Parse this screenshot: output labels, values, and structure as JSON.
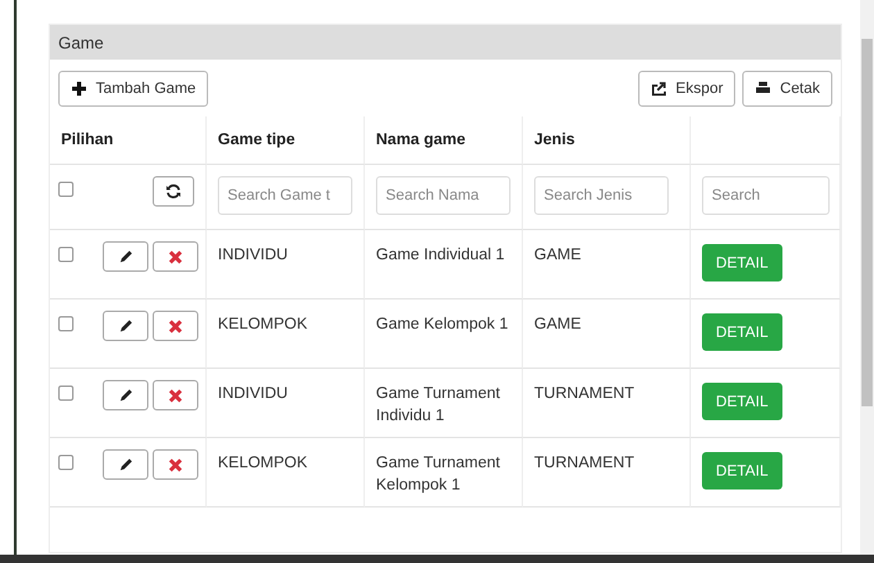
{
  "panel": {
    "title": "Game"
  },
  "toolbar": {
    "add_button": "Tambah Game",
    "export_button": "Ekspor",
    "print_button": "Cetak"
  },
  "table": {
    "columns": [
      "Pilihan",
      "Game tipe",
      "Nama game",
      "Jenis"
    ],
    "filters": {
      "select_all_checked": false,
      "placeholders": [
        "Search Game t",
        "Search Nama",
        "Search Jenis",
        "Search"
      ]
    },
    "rows": [
      {
        "checked": false,
        "game_tipe": "INDIVIDU",
        "nama_game": "Game Individual 1",
        "jenis": "GAME",
        "action": "DETAIL"
      },
      {
        "checked": false,
        "game_tipe": "KELOMPOK",
        "nama_game": "Game Kelompok 1",
        "jenis": "GAME",
        "action": "DETAIL"
      },
      {
        "checked": false,
        "game_tipe": "INDIVIDU",
        "nama_game": "Game Turnament Individu 1",
        "jenis": "TURNAMENT",
        "action": "DETAIL"
      },
      {
        "checked": false,
        "game_tipe": "KELOMPOK",
        "nama_game": "Game Turnament Kelompok 1",
        "jenis": "TURNAMENT",
        "action": "DETAIL"
      }
    ]
  }
}
